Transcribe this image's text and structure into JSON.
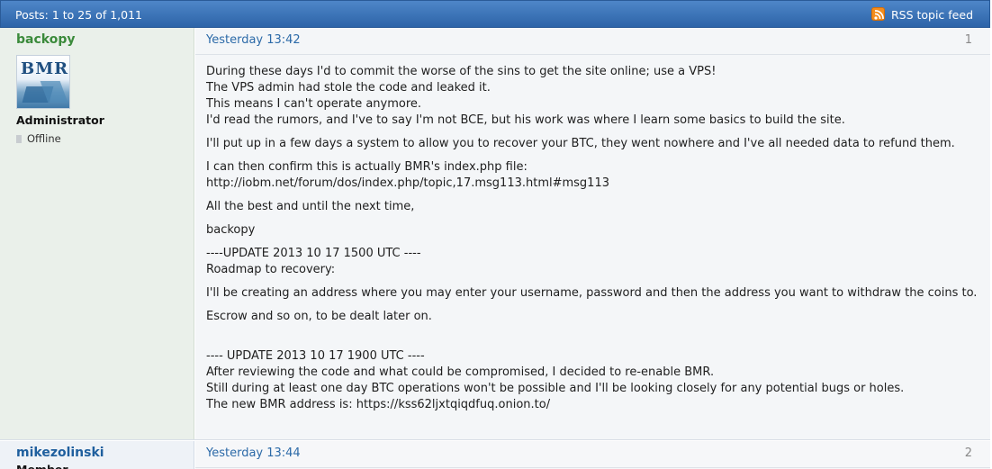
{
  "topbar": {
    "count_text": "Posts: 1 to 25 of 1,011",
    "rss_label": "RSS topic feed",
    "rss_icon": "rss-icon"
  },
  "posts": [
    {
      "author": {
        "name": "backopy",
        "avatar_text": "BMR",
        "role": "Administrator",
        "status": "Offline"
      },
      "date": "Yesterday 13:42",
      "number": "1",
      "paragraphs": [
        [
          "During these days I'd to commit the worse of the sins to get the site online; use a VPS!",
          "The VPS admin had stole the code and leaked it.",
          "This means I can't operate anymore.",
          "I'd read the rumors, and I've to say I'm not BCE, but his work was where I learn some basics to build the site."
        ],
        [
          "I'll put up in a few days a system to allow you to recover your BTC, they went nowhere and I've all needed data to refund them."
        ],
        [
          "I can then confirm this is actually BMR's index.php file:",
          "http://iobm.net/forum/dos/index.php/topic,17.msg113.html#msg113"
        ],
        [
          "All the best and until the next time,"
        ],
        [
          "backopy"
        ],
        [
          "----UPDATE 2013 10 17 1500 UTC ----",
          "Roadmap to recovery:"
        ],
        [
          "I'll be creating an address where you may enter your username, password and then the address you want to withdraw the coins to."
        ],
        [
          "Escrow and so on, to be dealt later on."
        ],
        [
          "---- UPDATE 2013 10 17 1900 UTC ----",
          "After reviewing the code and what could be compromised, I decided to re-enable BMR.",
          "Still during at least one day BTC operations won't be possible and I'll be looking closely for any potential bugs or holes.",
          "The new BMR address is: https://kss62ljxtqiqdfuq.onion.to/"
        ]
      ]
    },
    {
      "author": {
        "name": "mikezolinski",
        "role": "Member"
      },
      "date": "Yesterday 13:44",
      "number": "2"
    }
  ],
  "colors": {
    "topbar": "#3a72b8",
    "username_admin": "#3b8a3b",
    "username_member": "#1f5f9e",
    "link": "#2c6aa8"
  }
}
